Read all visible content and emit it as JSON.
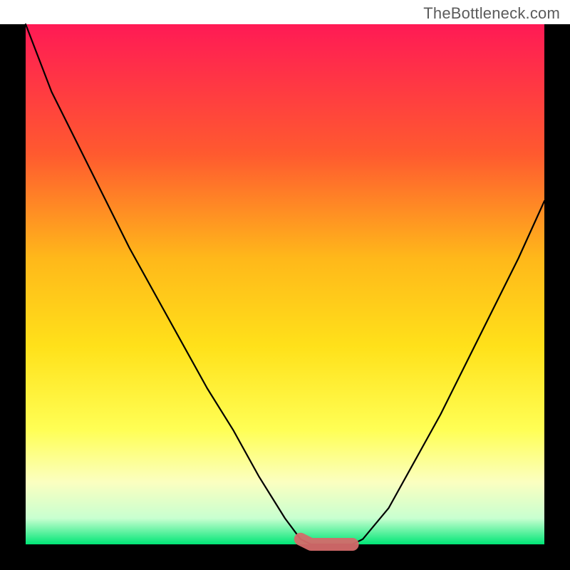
{
  "watermark": "TheBottleneck.com",
  "chart_data": {
    "type": "line",
    "title": "",
    "xlabel": "",
    "ylabel": "",
    "x": [
      0.0,
      0.05,
      0.1,
      0.15,
      0.2,
      0.25,
      0.3,
      0.35,
      0.4,
      0.45,
      0.5,
      0.53,
      0.55,
      0.58,
      0.6,
      0.63,
      0.65,
      0.7,
      0.75,
      0.8,
      0.85,
      0.9,
      0.95,
      1.0
    ],
    "series": [
      {
        "name": "bottleneck-curve",
        "values": [
          1.0,
          0.87,
          0.77,
          0.67,
          0.57,
          0.48,
          0.39,
          0.3,
          0.22,
          0.13,
          0.05,
          0.01,
          0.0,
          0.0,
          0.0,
          0.0,
          0.01,
          0.07,
          0.16,
          0.25,
          0.35,
          0.45,
          0.55,
          0.66
        ]
      }
    ],
    "highlight": {
      "name": "sweet-spot",
      "x_range": [
        0.53,
        0.63
      ],
      "color": "#d46a6a"
    },
    "xlim": [
      0,
      1
    ],
    "ylim": [
      0,
      1
    ],
    "grid": false,
    "background_gradient": [
      "#ff1a55",
      "#ff8a2a",
      "#ffe11a",
      "#ffff77",
      "#e8ffe8",
      "#00e676"
    ],
    "frame_color": "#000000"
  }
}
